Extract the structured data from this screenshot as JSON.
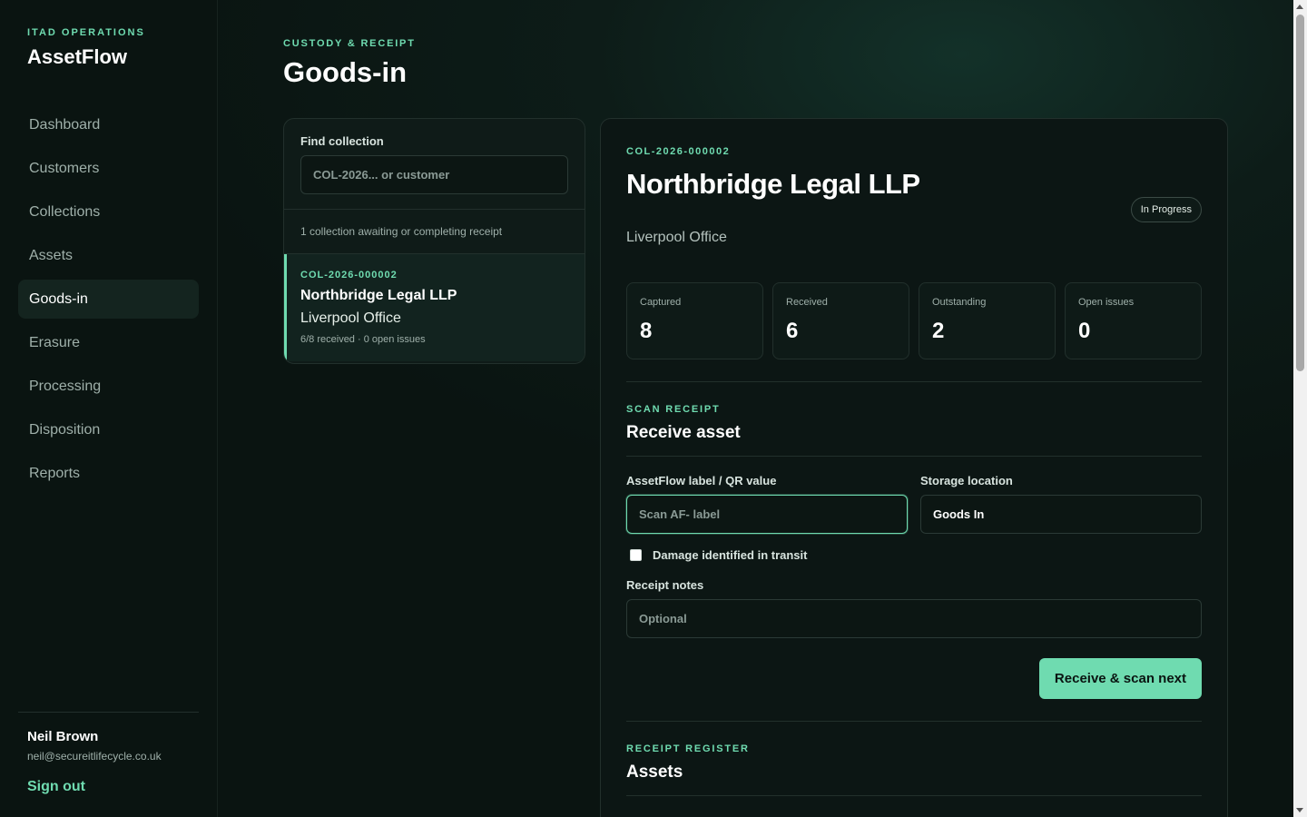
{
  "sidebar": {
    "eyebrow": "ITAD OPERATIONS",
    "brand": "AssetFlow",
    "items": [
      {
        "label": "Dashboard"
      },
      {
        "label": "Customers"
      },
      {
        "label": "Collections"
      },
      {
        "label": "Assets"
      },
      {
        "label": "Goods-in"
      },
      {
        "label": "Erasure"
      },
      {
        "label": "Processing"
      },
      {
        "label": "Disposition"
      },
      {
        "label": "Reports"
      }
    ],
    "active": "Goods-in",
    "user": {
      "name": "Neil Brown",
      "email": "neil@secureitlifecycle.co.uk",
      "signout": "Sign out"
    }
  },
  "header": {
    "eyebrow": "CUSTODY & RECEIPT",
    "title": "Goods-in"
  },
  "find": {
    "label": "Find collection",
    "placeholder": "COL-2026... or customer",
    "awaiting": "1 collection awaiting or completing receipt"
  },
  "collection_list": [
    {
      "id": "COL-2026-000002",
      "name": "Northbridge Legal LLP",
      "site": "Liverpool Office",
      "meta": "6/8 received · 0 open issues"
    }
  ],
  "detail": {
    "id": "COL-2026-000002",
    "title": "Northbridge Legal LLP",
    "site": "Liverpool Office",
    "status": "In Progress",
    "stats": [
      {
        "label": "Captured",
        "value": "8"
      },
      {
        "label": "Received",
        "value": "6"
      },
      {
        "label": "Outstanding",
        "value": "2"
      },
      {
        "label": "Open issues",
        "value": "0"
      }
    ]
  },
  "scan": {
    "eyebrow": "SCAN RECEIPT",
    "title": "Receive asset",
    "label_field": {
      "label": "AssetFlow label / QR value",
      "placeholder": "Scan AF- label"
    },
    "storage_field": {
      "label": "Storage location",
      "value": "Goods In"
    },
    "damage_label": "Damage identified in transit",
    "notes_field": {
      "label": "Receipt notes",
      "placeholder": "Optional"
    },
    "submit": "Receive & scan next"
  },
  "register": {
    "eyebrow": "RECEIPT REGISTER",
    "title": "Assets"
  }
}
